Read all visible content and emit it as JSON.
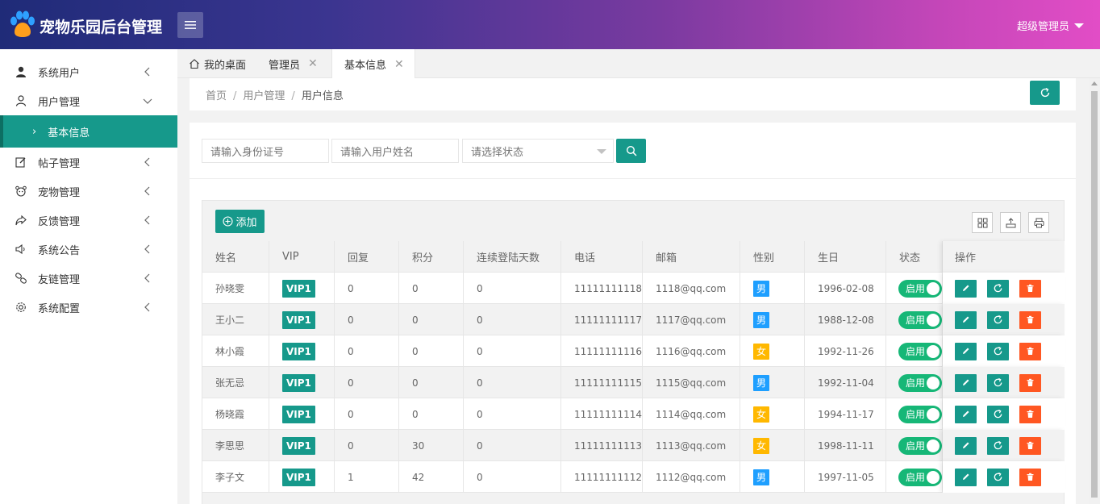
{
  "header": {
    "brand": "宠物乐园后台管理",
    "admin": "超级管理员"
  },
  "sidebar": {
    "items": [
      {
        "label": "系统用户",
        "icon": "user-icon"
      },
      {
        "label": "用户管理",
        "icon": "user-outline-icon"
      },
      {
        "label": "基本信息",
        "icon": "chevron-right-icon"
      },
      {
        "label": "帖子管理",
        "icon": "edit-icon"
      },
      {
        "label": "宠物管理",
        "icon": "pet-icon"
      },
      {
        "label": "反馈管理",
        "icon": "share-icon"
      },
      {
        "label": "系统公告",
        "icon": "speaker-icon"
      },
      {
        "label": "友链管理",
        "icon": "link-icon"
      },
      {
        "label": "系统配置",
        "icon": "gear-icon"
      }
    ]
  },
  "tabs": [
    {
      "label": "我的桌面"
    },
    {
      "label": "管理员"
    },
    {
      "label": "基本信息"
    }
  ],
  "breadcrumb": {
    "home": "首页",
    "section": "用户管理",
    "current": "用户信息",
    "sep": "/"
  },
  "search": {
    "id_placeholder": "请输入身份证号",
    "name_placeholder": "请输入用户姓名",
    "status_placeholder": "请选择状态"
  },
  "toolbar": {
    "add_label": "添加"
  },
  "table": {
    "headers": [
      "姓名",
      "VIP",
      "回复",
      "积分",
      "连续登陆天数",
      "电话",
      "邮箱",
      "性别",
      "生日",
      "状态",
      "操作"
    ],
    "rows": [
      {
        "name": "孙晓雯",
        "vip": "VIP1",
        "reply": "0",
        "points": "0",
        "days": "0",
        "phone": "11111111118",
        "email": "1118@qq.com",
        "sex": "男",
        "birthday": "1996-02-08",
        "status": "启用"
      },
      {
        "name": "王小二",
        "vip": "VIP1",
        "reply": "0",
        "points": "0",
        "days": "0",
        "phone": "11111111117",
        "email": "1117@qq.com",
        "sex": "男",
        "birthday": "1988-12-08",
        "status": "启用"
      },
      {
        "name": "林小霞",
        "vip": "VIP1",
        "reply": "0",
        "points": "0",
        "days": "0",
        "phone": "11111111116",
        "email": "1116@qq.com",
        "sex": "女",
        "birthday": "1992-11-26",
        "status": "启用"
      },
      {
        "name": "张无忌",
        "vip": "VIP1",
        "reply": "0",
        "points": "0",
        "days": "0",
        "phone": "11111111115",
        "email": "1115@qq.com",
        "sex": "男",
        "birthday": "1992-11-04",
        "status": "启用"
      },
      {
        "name": "杨晓霞",
        "vip": "VIP1",
        "reply": "0",
        "points": "0",
        "days": "0",
        "phone": "11111111114",
        "email": "1114@qq.com",
        "sex": "女",
        "birthday": "1994-11-17",
        "status": "启用"
      },
      {
        "name": "李思思",
        "vip": "VIP1",
        "reply": "0",
        "points": "30",
        "days": "0",
        "phone": "11111111113",
        "email": "1113@qq.com",
        "sex": "女",
        "birthday": "1998-11-11",
        "status": "启用"
      },
      {
        "name": "李子文",
        "vip": "VIP1",
        "reply": "1",
        "points": "42",
        "days": "0",
        "phone": "11111111112",
        "email": "1112@qq.com",
        "sex": "男",
        "birthday": "1997-11-05",
        "status": "启用"
      }
    ]
  },
  "colors": {
    "accent": "#16998b",
    "male": "#1e9fff",
    "female": "#ffb800",
    "delete": "#ff5722",
    "switch_on": "#16b777"
  }
}
